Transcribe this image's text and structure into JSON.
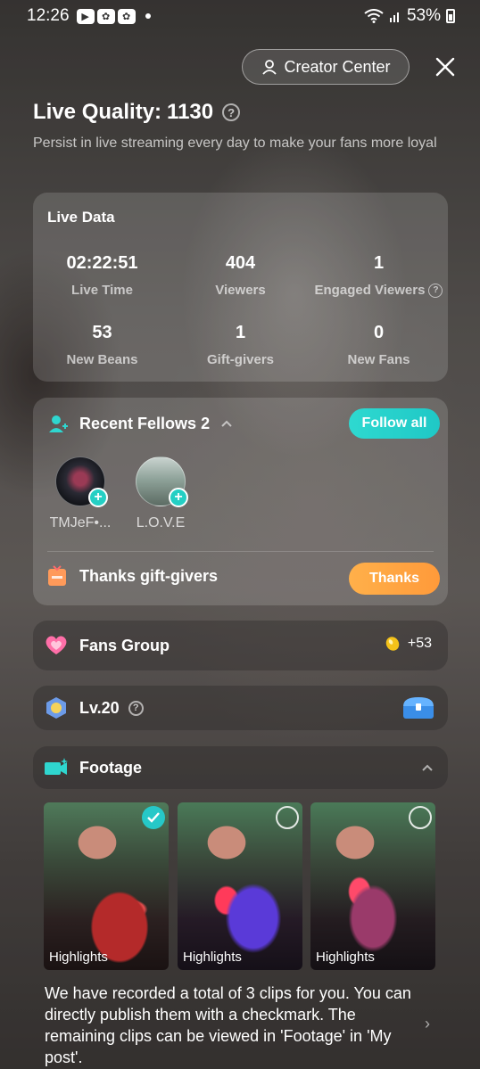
{
  "status_bar": {
    "time": "12:26",
    "battery": "53%"
  },
  "header": {
    "creator_center_label": "Creator Center",
    "title_label": "Live Quality:",
    "title_value": "1130",
    "subtitle": "Persist in live streaming every day to make your fans more loyal"
  },
  "live_data": {
    "heading": "Live Data",
    "stats": [
      {
        "value": "02:22:51",
        "label": "Live Time"
      },
      {
        "value": "404",
        "label": "Viewers"
      },
      {
        "value": "1",
        "label": "Engaged Viewers"
      },
      {
        "value": "53",
        "label": "New Beans"
      },
      {
        "value": "1",
        "label": "Gift-givers"
      },
      {
        "value": "0",
        "label": "New Fans"
      }
    ]
  },
  "recent_fellows": {
    "heading": "Recent Fellows",
    "count": "2",
    "follow_all_label": "Follow all",
    "fellows": [
      {
        "name": "TMJeF•..."
      },
      {
        "name": "L.O.V.E"
      }
    ],
    "thanks_text": "Thanks gift-givers",
    "thanks_button": "Thanks"
  },
  "fans_group": {
    "label": "Fans Group",
    "beans": "+53"
  },
  "level": {
    "label": "Lv.20"
  },
  "footage": {
    "label": "Footage",
    "clips": [
      {
        "caption": "Highlights",
        "selected": true
      },
      {
        "caption": "Highlights",
        "selected": false
      },
      {
        "caption": "Highlights",
        "selected": false
      }
    ],
    "note": "We have recorded a total of 3 clips for you. You can directly publish them with a checkmark. The remaining clips can be viewed in 'Footage' in 'My post'."
  },
  "colors": {
    "teal_accent": "#24cfc4",
    "orange_accent": "#ff9a3a",
    "card_bg": "rgba(255,255,255,0.15)"
  }
}
